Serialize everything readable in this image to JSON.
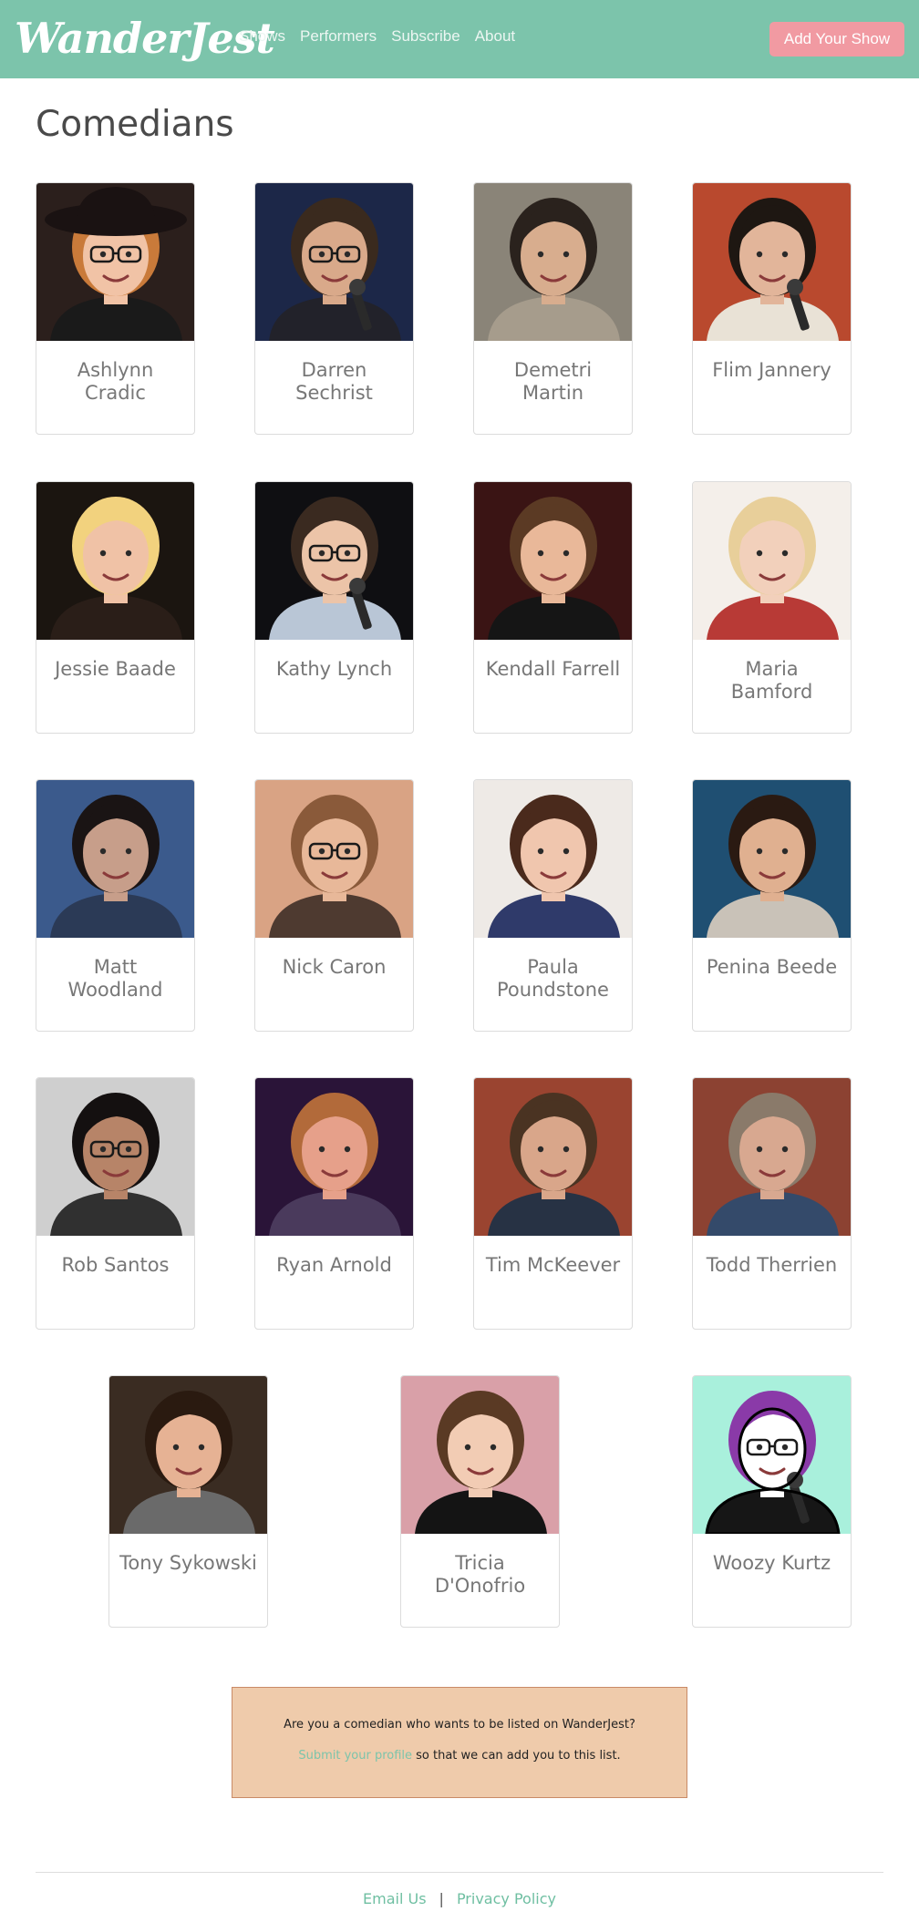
{
  "brand": {
    "name": "WanderJest"
  },
  "nav": {
    "links": [
      "Shows",
      "Performers",
      "Subscribe",
      "About"
    ],
    "cta_label": "Add Your Show"
  },
  "page": {
    "title": "Comedians"
  },
  "comedians": [
    {
      "name": "Ashlynn Cradic",
      "bg": "#2b1f1c",
      "hair": "#c97a3a",
      "skin": "#f1c3a6",
      "shirt": "#1a1a1a",
      "hat": true,
      "glasses": true
    },
    {
      "name": "Darren Sechrist",
      "bg": "#1c2748",
      "hair": "#3a2a1e",
      "skin": "#d9a98a",
      "shirt": "#22222a",
      "glasses": true,
      "mic": true
    },
    {
      "name": "Demetri Martin",
      "bg": "#8a8478",
      "hair": "#2a221d",
      "skin": "#d8ad8e",
      "shirt": "#a69c8c"
    },
    {
      "name": "Flim Jannery",
      "bg": "#b9492e",
      "hair": "#1e1712",
      "skin": "#e2b59a",
      "shirt": "#e9e2d6",
      "mic": true
    },
    {
      "name": "Jessie Baade",
      "bg": "#1b1510",
      "hair": "#f2d27e",
      "skin": "#f0c2a6",
      "shirt": "#2a1e18"
    },
    {
      "name": "Kathy Lynch",
      "bg": "#0f0f12",
      "hair": "#3a2a20",
      "skin": "#ecc4a8",
      "shirt": "#b9c6d6",
      "glasses": true,
      "mic": true
    },
    {
      "name": "Kendall Farrell",
      "bg": "#3a1414",
      "hair": "#5b3a24",
      "skin": "#e9b899",
      "shirt": "#151515"
    },
    {
      "name": "Maria Bamford",
      "bg": "#f4efea",
      "hair": "#e8cf9a",
      "skin": "#f2d0bb",
      "shirt": "#b83a36"
    },
    {
      "name": "Matt Woodland",
      "bg": "#3b5a8c",
      "hair": "#1a1414",
      "skin": "#c79e8a",
      "shirt": "#2b3a56"
    },
    {
      "name": "Nick Caron",
      "bg": "#d9a384",
      "hair": "#8a5a3a",
      "skin": "#e8b899",
      "shirt": "#4e3a30",
      "glasses": true
    },
    {
      "name": "Paula Poundstone",
      "bg": "#eeeae6",
      "hair": "#4a2a1c",
      "skin": "#f0c6ae",
      "shirt": "#2f3a6a"
    },
    {
      "name": "Penina Beede",
      "bg": "#1f4f72",
      "hair": "#2a1a12",
      "skin": "#e0b090",
      "shirt": "#c9c2b8"
    },
    {
      "name": "Rob Santos",
      "bg": "#cfcfcf",
      "hair": "#141010",
      "skin": "#b78468",
      "shirt": "#303030",
      "glasses": true
    },
    {
      "name": "Ryan Arnold",
      "bg": "#2a1438",
      "hair": "#b26a3a",
      "skin": "#e6a08a",
      "shirt": "#4a3a5c"
    },
    {
      "name": "Tim McKeever",
      "bg": "#9a4430",
      "hair": "#4a3322",
      "skin": "#d9a68a",
      "shirt": "#273244"
    },
    {
      "name": "Todd Therrien",
      "bg": "#8c4232",
      "hair": "#8a7a6a",
      "skin": "#d8a890",
      "shirt": "#344a6a"
    },
    {
      "name": "Tony Sykowski",
      "bg": "#3a2c22",
      "hair": "#2a1a10",
      "skin": "#e6b294",
      "shirt": "#6a6a6a"
    },
    {
      "name": "Tricia D'Onofrio",
      "bg": "#d9a0a8",
      "hair": "#5a3a24",
      "skin": "#f2ccb4",
      "shirt": "#141414"
    },
    {
      "name": "Woozy Kurtz",
      "bg": "#a9f0dc",
      "hair": "#8a3aa8",
      "skin": "#ffffff",
      "shirt": "#161616",
      "glasses": true,
      "mic": true,
      "cartoon": true
    }
  ],
  "signup": {
    "question": "Are you a comedian who wants to be listed on WanderJest?",
    "link_text": "Submit your profile",
    "rest_text": " so that we can add you to this list."
  },
  "footer": {
    "email_label": "Email Us",
    "privacy_label": "Privacy Policy",
    "separator": "|"
  },
  "colors": {
    "header": "#7cc4ab",
    "cta_button": "#f19aa2",
    "signup_bg": "#efcbab",
    "link": "#7cc4ab"
  }
}
